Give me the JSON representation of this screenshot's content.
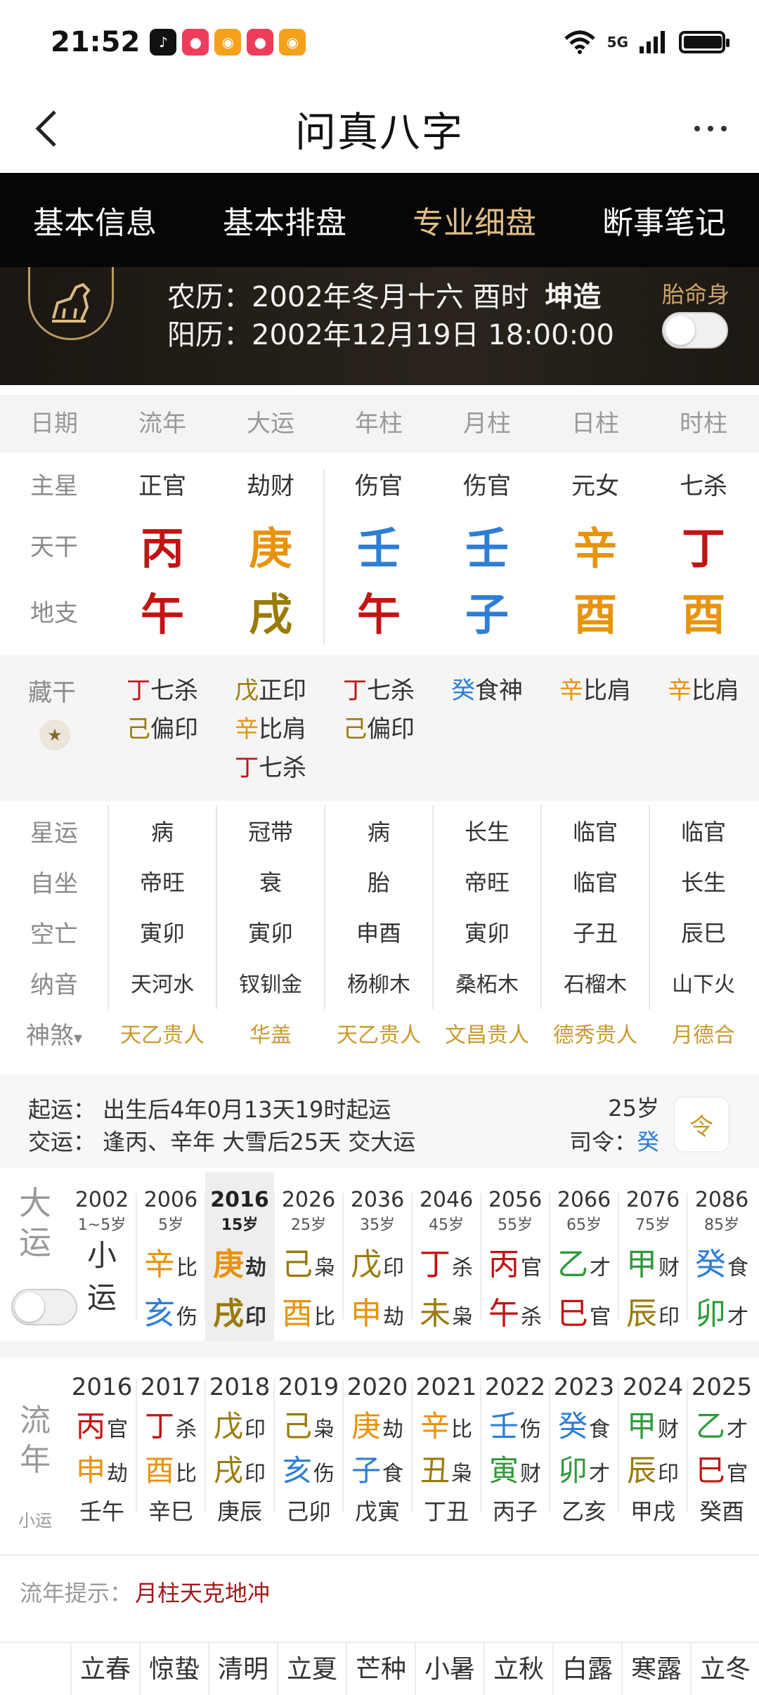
{
  "status_bar": {
    "time": "21:52",
    "network": "5G"
  },
  "header": {
    "title": "问真八字"
  },
  "tabs": [
    "基本信息",
    "基本排盘",
    "专业细盘",
    "断事笔记"
  ],
  "active_tab": "专业细盘",
  "profile": {
    "lunar_label": "农历：",
    "lunar_value": "2002年冬月十六 酉时",
    "gender": "坤造",
    "solar_label": "阳历：",
    "solar_value": "2002年12月19日 18:00:00",
    "taiming_label": "胎命身"
  },
  "pillar_header": [
    "日期",
    "流年",
    "大运",
    "年柱",
    "月柱",
    "日柱",
    "时柱"
  ],
  "main_star": {
    "label": "主星",
    "values": [
      "正官",
      "劫财",
      "伤官",
      "伤官",
      "元女",
      "七杀"
    ]
  },
  "tiangan": {
    "label": "天干",
    "values": [
      "丙",
      "庚",
      "壬",
      "壬",
      "辛",
      "丁"
    ],
    "colors": [
      "#c21414",
      "#e8930d",
      "#2d7ed6",
      "#2d7ed6",
      "#e8930d",
      "#c21414"
    ]
  },
  "dizhi": {
    "label": "地支",
    "values": [
      "午",
      "戌",
      "午",
      "子",
      "酉",
      "酉"
    ],
    "colors": [
      "#c21414",
      "#9a7b0a",
      "#c21414",
      "#2d7ed6",
      "#e8930d",
      "#e8930d"
    ]
  },
  "canggan": {
    "label": "藏干",
    "columns": [
      [
        [
          "丁",
          "七杀",
          "#c21414"
        ],
        [
          "己",
          "偏印",
          "#9a7b0a"
        ]
      ],
      [
        [
          "戊",
          "正印",
          "#9a7b0a"
        ],
        [
          "辛",
          "比肩",
          "#e8930d"
        ],
        [
          "丁",
          "七杀",
          "#c21414"
        ]
      ],
      [
        [
          "丁",
          "七杀",
          "#c21414"
        ],
        [
          "己",
          "偏印",
          "#9a7b0a"
        ]
      ],
      [
        [
          "癸",
          "食神",
          "#2d7ed6"
        ]
      ],
      [
        [
          "辛",
          "比肩",
          "#e8930d"
        ]
      ],
      [
        [
          "辛",
          "比肩",
          "#e8930d"
        ]
      ]
    ]
  },
  "xingyun": {
    "label": "星运",
    "values": [
      "病",
      "冠带",
      "病",
      "长生",
      "临官",
      "临官"
    ]
  },
  "zizuo": {
    "label": "自坐",
    "values": [
      "帝旺",
      "衰",
      "胎",
      "帝旺",
      "临官",
      "长生"
    ]
  },
  "kongwang": {
    "label": "空亡",
    "values": [
      "寅卯",
      "寅卯",
      "申酉",
      "寅卯",
      "子丑",
      "辰巳"
    ]
  },
  "nayin": {
    "label": "纳音",
    "values": [
      "天河水",
      "钗钏金",
      "杨柳木",
      "桑柘木",
      "石榴木",
      "山下火"
    ]
  },
  "shensha": {
    "label": "神煞",
    "arrow": "▾",
    "values": [
      "天乙贵人",
      "华盖",
      "天乙贵人",
      "文昌贵人",
      "德秀贵人",
      "月德合"
    ]
  },
  "qiyun": {
    "line1": "起运：  出生后4年0月13天19时起运",
    "line2": "交运：  逢丙、辛年 大雪后25天 交大运",
    "age": "25岁",
    "siling_label": "司令：",
    "siling_value": "癸",
    "calendar_icon_text": "令"
  },
  "dayun": {
    "label": "大运",
    "selected_index": 2,
    "columns": [
      {
        "year": "2002",
        "age": "1~5岁",
        "xiao": [
          "小",
          "运"
        ]
      },
      {
        "year": "2006",
        "age": "5岁",
        "gan": "辛",
        "gan_color": "#e8930d",
        "gan_ss": "比",
        "zhi": "亥",
        "zhi_color": "#2d7ed6",
        "zhi_ss": "伤"
      },
      {
        "year": "2016",
        "age": "15岁",
        "gan": "庚",
        "gan_color": "#e8930d",
        "gan_ss": "劫",
        "zhi": "戌",
        "zhi_color": "#9a7b0a",
        "zhi_ss": "印"
      },
      {
        "year": "2026",
        "age": "25岁",
        "gan": "己",
        "gan_color": "#9a7b0a",
        "gan_ss": "枭",
        "zhi": "酉",
        "zhi_color": "#e8930d",
        "zhi_ss": "比"
      },
      {
        "year": "2036",
        "age": "35岁",
        "gan": "戊",
        "gan_color": "#9a7b0a",
        "gan_ss": "印",
        "zhi": "申",
        "zhi_color": "#e8930d",
        "zhi_ss": "劫"
      },
      {
        "year": "2046",
        "age": "45岁",
        "gan": "丁",
        "gan_color": "#c21414",
        "gan_ss": "杀",
        "zhi": "未",
        "zhi_color": "#9a7b0a",
        "zhi_ss": "枭"
      },
      {
        "year": "2056",
        "age": "55岁",
        "gan": "丙",
        "gan_color": "#c21414",
        "gan_ss": "官",
        "zhi": "午",
        "zhi_color": "#c21414",
        "zhi_ss": "杀"
      },
      {
        "year": "2066",
        "age": "65岁",
        "gan": "乙",
        "gan_color": "#2f9a3a",
        "gan_ss": "才",
        "zhi": "巳",
        "zhi_color": "#c21414",
        "zhi_ss": "官"
      },
      {
        "year": "2076",
        "age": "75岁",
        "gan": "甲",
        "gan_color": "#2f9a3a",
        "gan_ss": "财",
        "zhi": "辰",
        "zhi_color": "#9a7b0a",
        "zhi_ss": "印"
      },
      {
        "year": "2086",
        "age": "85岁",
        "gan": "癸",
        "gan_color": "#2d7ed6",
        "gan_ss": "食",
        "zhi": "卯",
        "zhi_color": "#2f9a3a",
        "zhi_ss": "才"
      }
    ]
  },
  "liunian": {
    "label": "流年",
    "sub_label": "小运",
    "columns": [
      {
        "year": "2016",
        "gan": "丙",
        "gan_color": "#c21414",
        "gan_ss": "官",
        "zhi": "申",
        "zhi_color": "#e8930d",
        "zhi_ss": "劫",
        "xiao": "壬午"
      },
      {
        "year": "2017",
        "gan": "丁",
        "gan_color": "#c21414",
        "gan_ss": "杀",
        "zhi": "酉",
        "zhi_color": "#e8930d",
        "zhi_ss": "比",
        "xiao": "辛巳"
      },
      {
        "year": "2018",
        "gan": "戊",
        "gan_color": "#9a7b0a",
        "gan_ss": "印",
        "zhi": "戌",
        "zhi_color": "#9a7b0a",
        "zhi_ss": "印",
        "xiao": "庚辰"
      },
      {
        "year": "2019",
        "gan": "己",
        "gan_color": "#9a7b0a",
        "gan_ss": "枭",
        "zhi": "亥",
        "zhi_color": "#2d7ed6",
        "zhi_ss": "伤",
        "xiao": "己卯"
      },
      {
        "year": "2020",
        "gan": "庚",
        "gan_color": "#e8930d",
        "gan_ss": "劫",
        "zhi": "子",
        "zhi_color": "#2d7ed6",
        "zhi_ss": "食",
        "xiao": "戊寅"
      },
      {
        "year": "2021",
        "gan": "辛",
        "gan_color": "#e8930d",
        "gan_ss": "比",
        "zhi": "丑",
        "zhi_color": "#9a7b0a",
        "zhi_ss": "枭",
        "xiao": "丁丑"
      },
      {
        "year": "2022",
        "gan": "壬",
        "gan_color": "#2d7ed6",
        "gan_ss": "伤",
        "zhi": "寅",
        "zhi_color": "#2f9a3a",
        "zhi_ss": "财",
        "xiao": "丙子"
      },
      {
        "year": "2023",
        "gan": "癸",
        "gan_color": "#2d7ed6",
        "gan_ss": "食",
        "zhi": "卯",
        "zhi_color": "#2f9a3a",
        "zhi_ss": "才",
        "xiao": "乙亥"
      },
      {
        "year": "2024",
        "gan": "甲",
        "gan_color": "#2f9a3a",
        "gan_ss": "财",
        "zhi": "辰",
        "zhi_color": "#9a7b0a",
        "zhi_ss": "印",
        "xiao": "甲戌"
      },
      {
        "year": "2025",
        "gan": "乙",
        "gan_color": "#2f9a3a",
        "gan_ss": "才",
        "zhi": "巳",
        "zhi_color": "#c21414",
        "zhi_ss": "官",
        "xiao": "癸酉"
      }
    ]
  },
  "tip": {
    "label": "流年提示：",
    "value": "月柱天克地冲"
  },
  "jieqi": [
    "立春",
    "惊蛰",
    "清明",
    "立夏",
    "芒种",
    "小暑",
    "立秋",
    "白露",
    "寒露",
    "立冬"
  ]
}
